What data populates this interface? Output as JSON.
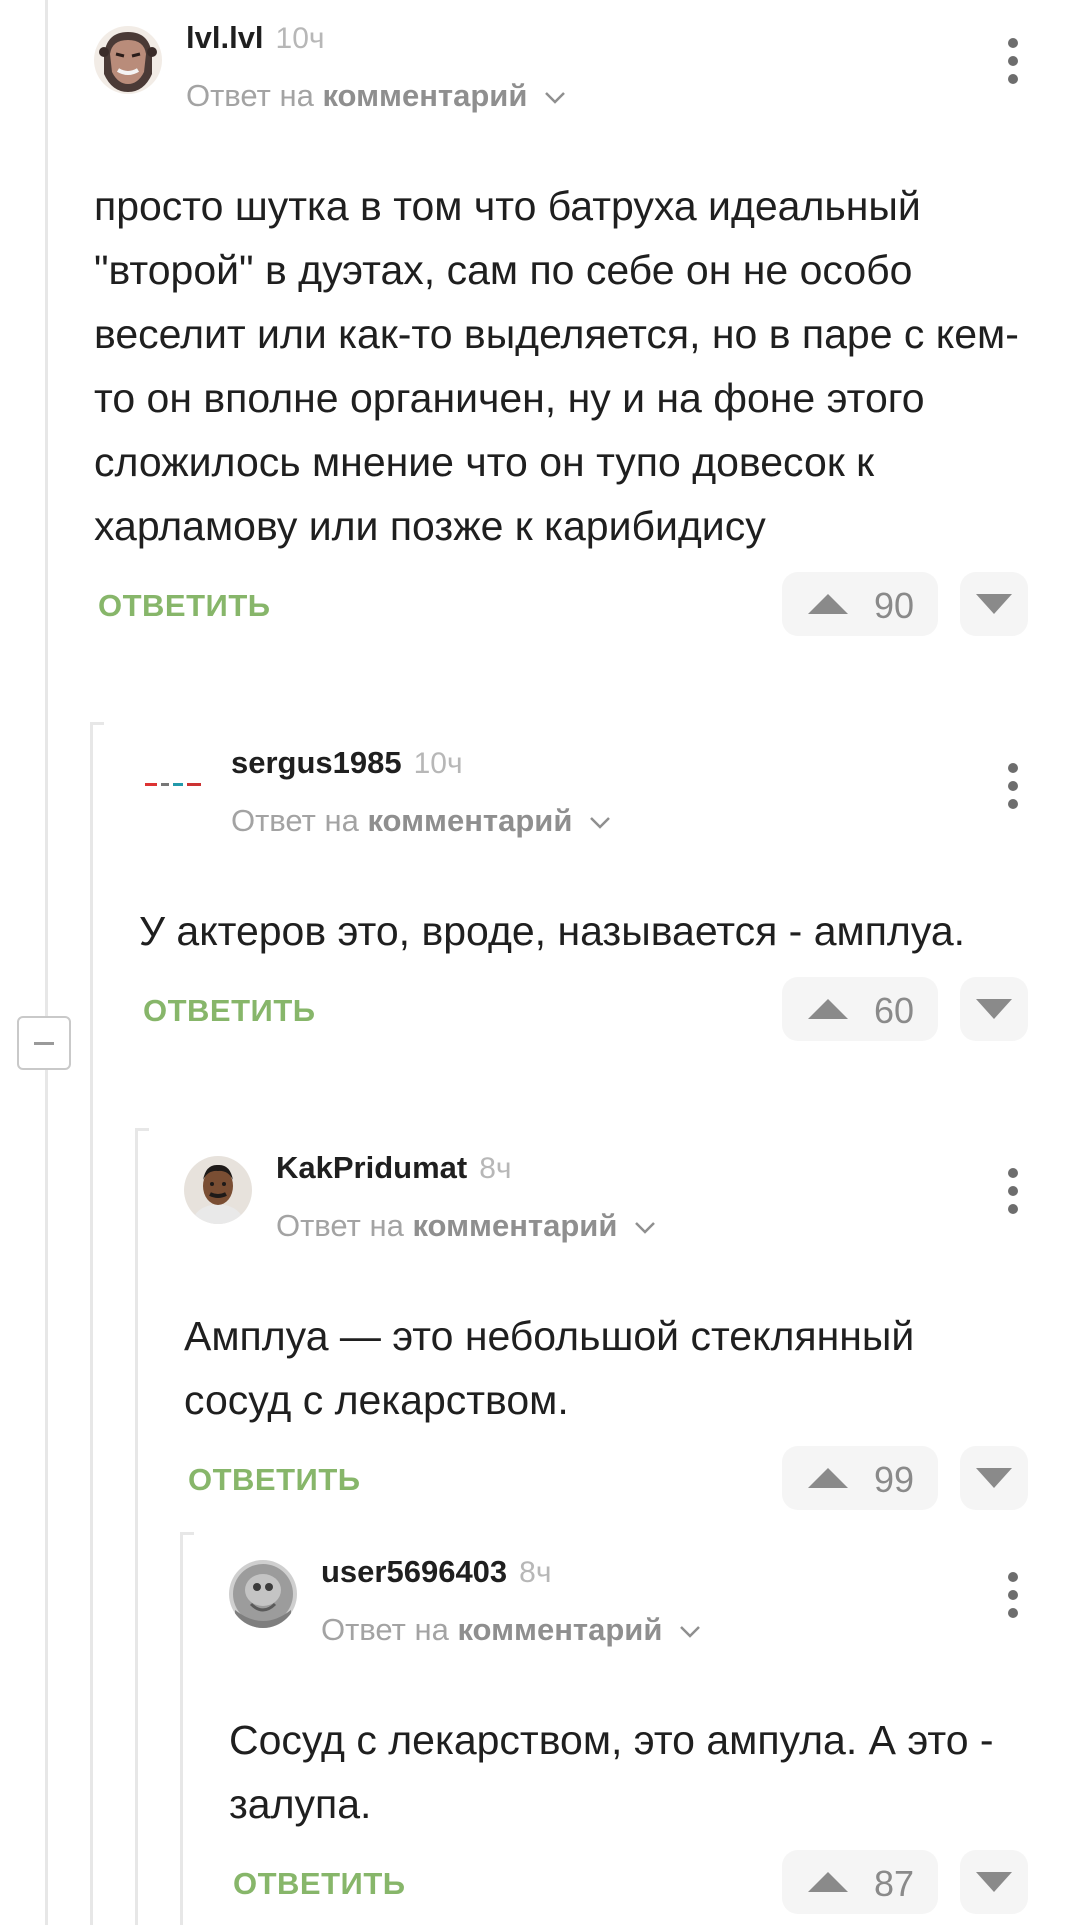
{
  "comments": [
    {
      "username": "lvl.lvl",
      "time": "10ч",
      "reply_prefix": "Ответ на",
      "reply_target": "комментарий",
      "text": "просто шутка в том что батруха идеальный \"второй\" в дуэтах, сам по себе он не особо веселит или как-то выделяется, но в паре с кем-то он вполне органичен, ну и на фоне этого сложилось мнение что он тупо довесок к харламову или позже к карибидису",
      "reply_label": "ОТВЕТИТЬ",
      "votes": "90"
    },
    {
      "username": "sergus1985",
      "time": "10ч",
      "reply_prefix": "Ответ на",
      "reply_target": "комментарий",
      "text": "У актеров это, вроде, называется - амплуа.",
      "reply_label": "ОТВЕТИТЬ",
      "votes": "60"
    },
    {
      "username": "KakPridumat",
      "time": "8ч",
      "reply_prefix": "Ответ на",
      "reply_target": "комментарий",
      "text": "Амплуа — это небольшой стеклянный сосуд с лекарством.",
      "reply_label": "ОТВЕТИТЬ",
      "votes": "99"
    },
    {
      "username": "user5696403",
      "time": "8ч",
      "reply_prefix": "Ответ на",
      "reply_target": "комментарий",
      "text": "Сосуд с лекарством, это ампула. А это - залупа.",
      "reply_label": "ОТВЕТИТЬ",
      "votes": "87"
    }
  ],
  "icons": {
    "collapse": "minus-icon",
    "chevron": "chevron-down-icon",
    "menu": "more-vertical-icon",
    "upvote": "triangle-up-icon",
    "downvote": "triangle-down-icon"
  },
  "colors": {
    "reply_accent": "#87b66a",
    "thread_line": "#e7e7e7",
    "muted_text": "#a3a3a3",
    "vote_bg": "#f5f5f5"
  }
}
